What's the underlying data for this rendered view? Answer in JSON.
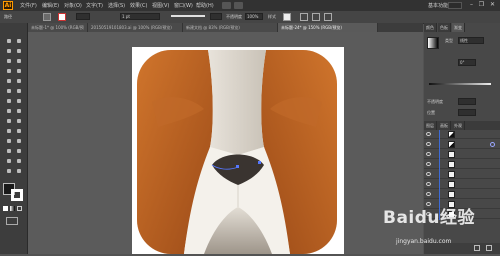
{
  "app": {
    "logo": "Ai"
  },
  "menu": {
    "items": [
      "文件(F)",
      "编辑(E)",
      "对象(O)",
      "文字(T)",
      "选择(S)",
      "效果(C)",
      "视图(V)",
      "窗口(W)",
      "帮助(H)"
    ],
    "workspace": "基本功能"
  },
  "control": {
    "label": "路径",
    "stroke_weight": "1 pt",
    "opacity_label": "不透明度",
    "opacity_value": "100%",
    "style_label": "样式"
  },
  "tabs": [
    {
      "label": "未标题-1* @ 100% (RGB/预览)"
    },
    {
      "label": "20150519101803.ai @ 100% (RGB/预览)"
    },
    {
      "label": "新建文档 @ 83% (RGB/预览)"
    },
    {
      "label": "未标题-24* @ 150% (RGB/预览)"
    }
  ],
  "panels": {
    "tabs": [
      "颜色",
      "色板",
      "渐变"
    ],
    "gradient_type_label": "类型",
    "gradient_type_value": "线性",
    "angle_value": "0°",
    "opacity_label": "不透明度",
    "position_label": "位置"
  },
  "layers": {
    "tabs": [
      "图层",
      "画板",
      "外观"
    ]
  },
  "colors": {
    "ear_dark": "#a3511c",
    "ear_light": "#d0752c",
    "face_light": "#efece6",
    "face_mid": "#d9d4cc",
    "nose": "#3a3430",
    "accent": "#ff9a00"
  },
  "watermark": {
    "line1": "Baidu经验",
    "line2": "jingyan.baidu.com"
  }
}
